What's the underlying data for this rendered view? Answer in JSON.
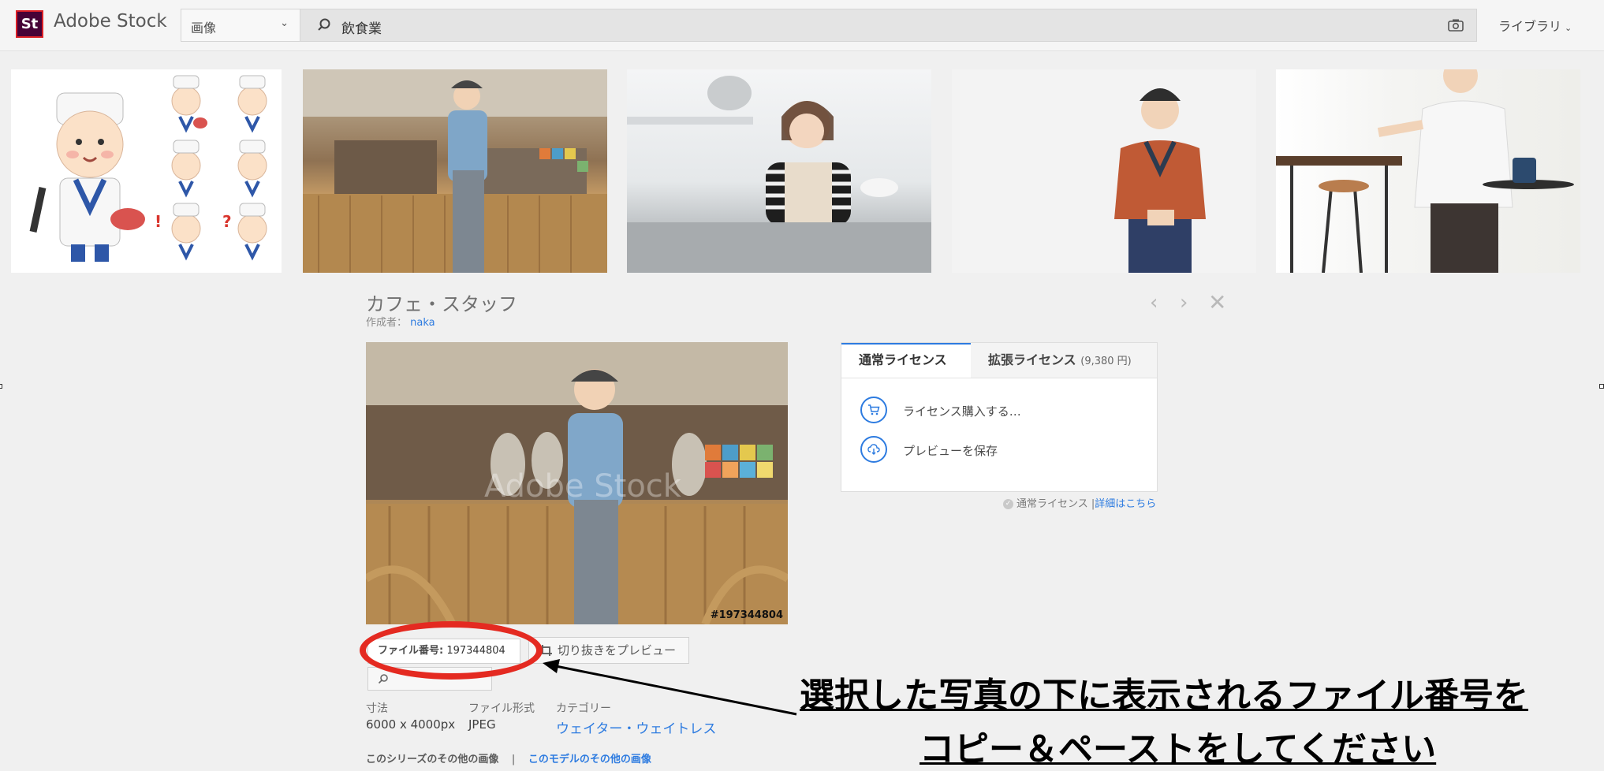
{
  "app": {
    "logo_mark": "St",
    "logo_text": "Adobe Stock"
  },
  "search": {
    "filter_value": "画像",
    "query": "飲食業"
  },
  "header": {
    "library_label": "ライブラリ"
  },
  "detail": {
    "title": "カフェ・スタッフ",
    "author_label": "作成者：",
    "author_name": "naka",
    "watermark": "Adobe Stock",
    "file_badge": "#197344804",
    "file_number_label": "ファイル番号:",
    "file_number": "197344804",
    "crop_preview_label": "切り抜きをプレビュー",
    "specs": {
      "size_label": "寸法",
      "size_value": "6000 x 4000px",
      "format_label": "ファイル形式",
      "format_value": "JPEG",
      "category_label": "カテゴリー",
      "category_value": "ウェイター・ウェイトレス"
    },
    "more_series": "このシリーズのその他の画像",
    "separator": "|",
    "more_model": "このモデルのその他の画像"
  },
  "license": {
    "tab_standard": "通常ライセンス",
    "tab_extended": "拡張ライセンス",
    "tab_extended_price": "(9,380 円)",
    "action_buy": "ライセンス購入する…",
    "action_save_preview": "プレビューを保存",
    "note_text": "通常ライセンス |",
    "note_link": "詳細はこちら"
  },
  "annotation": {
    "line1": "選択した写真の下に表示されるファイル番号を",
    "line2": "コピー＆ペーストをしてください"
  },
  "colors": {
    "accent_blue": "#2d7be0",
    "brand_bg": "#470137",
    "brand_border": "#da1f26",
    "annotation_red": "#e42a21"
  }
}
